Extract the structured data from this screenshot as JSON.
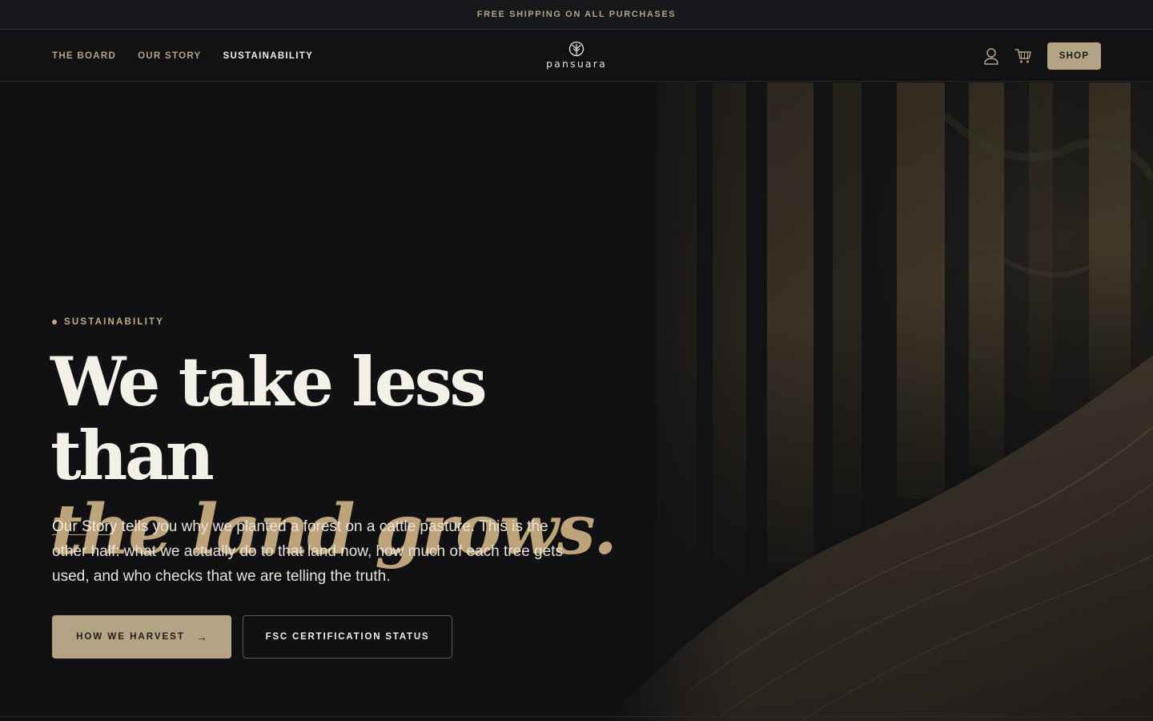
{
  "announcement": {
    "text": "FREE SHIPPING ON ALL PURCHASES"
  },
  "nav": {
    "items": [
      {
        "label": "THE BOARD",
        "active": false
      },
      {
        "label": "OUR STORY",
        "active": false
      },
      {
        "label": "SUSTAINABILITY",
        "active": true
      }
    ]
  },
  "brand": {
    "name": "pansuara",
    "icon": "tree-logo-icon"
  },
  "header_actions": {
    "account_icon": "user-icon",
    "cart_icon": "cart-icon",
    "shop_label": "SHOP"
  },
  "hero": {
    "eyebrow": "SUSTAINABILITY",
    "headline_line1": "We take less than",
    "headline_line2": "the land grows.",
    "lede_link": "Our Story",
    "lede_rest": " tells you why we planted a forest on a cattle pasture. This is the other half: what we actually do to that land now, how much of each tree gets used, and who checks that we are telling the truth.",
    "primary_cta": "HOW WE HARVEST",
    "primary_cta_arrow": "→",
    "secondary_cta": "FSC CERTIFICATION STATUS"
  },
  "colors": {
    "accent": "#b5a385",
    "headline_gold": "#bea47a",
    "background": "#121214",
    "text_light": "#f3f0e8"
  }
}
